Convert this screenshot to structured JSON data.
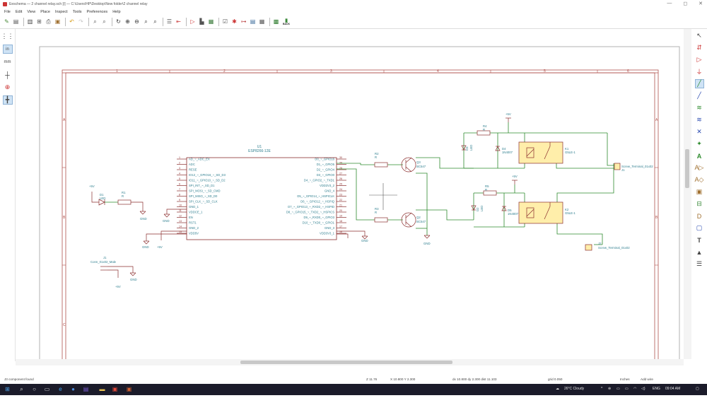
{
  "window": {
    "title": "Eeschema — 2 channel relay.sch [/] — C:\\Users\\HP\\Desktop\\New folder\\2 channel relay",
    "controls": [
      "—",
      "◻",
      "✕"
    ]
  },
  "menu": [
    "File",
    "Edit",
    "View",
    "Place",
    "Inspect",
    "Tools",
    "Preferences",
    "Help"
  ],
  "toolbar": {
    "back_label": "BACK",
    "icons": [
      "new-schematic-icon",
      "open-schematic-icon",
      "save-icon",
      "page-settings-icon",
      "print-icon",
      "plot-icon",
      "paste-icon",
      "undo-icon",
      "redo-icon",
      "find-icon",
      "find-replace-icon",
      "refresh-icon",
      "zoom-in-icon",
      "zoom-out-icon",
      "zoom-fit-icon",
      "zoom-selection-icon",
      "hierarchy-navigator-icon",
      "leave-sheet-icon",
      "symbol-editor-icon",
      "symbol-browser-icon",
      "annotate-icon",
      "erc-icon",
      "netlist-icon",
      "assign-footprints-icon",
      "bom-icon",
      "pcbnew-icon"
    ]
  },
  "left_toolbar": [
    "grid-toggle-icon",
    "units-inches-icon",
    "units-mm-icon",
    "cursor-shape-icon",
    "hidden-pins-icon",
    "wire-orientation-icon"
  ],
  "right_toolbar": [
    "select-icon",
    "highlight-net-icon",
    "add-symbol-icon",
    "add-power-icon",
    "add-wire-icon",
    "add-bus-icon",
    "wire-to-bus-entry-icon",
    "bus-to-bus-entry-icon",
    "no-connect-icon",
    "add-junction-icon",
    "add-label-icon",
    "add-global-label-icon",
    "add-hier-label-icon",
    "add-hier-sheet-icon",
    "import-sheet-pin-icon",
    "add-sheet-pin-icon",
    "add-graphic-line-icon",
    "add-text-icon",
    "add-image-icon",
    "delete-icon"
  ],
  "schematic": {
    "border_numbers": [
      "1",
      "2",
      "3",
      "4",
      "5",
      "6"
    ],
    "border_letters": [
      "A",
      "B",
      "C"
    ],
    "u1": {
      "ref": "U1",
      "value": "ESP8266-12E",
      "left_pins": [
        "AD_~_ADC_EX",
        "ADC",
        "RESE",
        "IO12_~_GPIO16_~_SD_D3",
        "IO11_~_GPIO10_~_SD_D2",
        "SPI_INT_~_SD_D1",
        "SPI_MOSI_~_SD_CMD",
        "SPI_MISO_~_SD_D0",
        "SPI_CLK_~_SD_CLK",
        "GND_1",
        "VDDCE_1",
        "EN",
        "RST1",
        "GND_2",
        "VDD5V"
      ],
      "right_pins": [
        "D0_~_GPIO16",
        "D1_~_GPIO5",
        "D2_~_GPIO4",
        "D3_~_GPIO0",
        "D4_~_GPIO2_~_TXD1",
        "VDD3V3_2",
        "GND_4",
        "D5_~_GPIO14_~_HSPICLK",
        "D6_~_GPIO12_~_HSPIQ",
        "D7_~_GPIO13_~_RXD2_~_HSPID",
        "D8_~_GPIO15_~_TXD2_~_HSPICS",
        "D9_~_RXD0_~_GPIO3",
        "D10_~_TXD0_~_GPIO1",
        "GND_3",
        "VDD3V3_1"
      ],
      "left_pin_numbers": [
        "1",
        "2",
        "3",
        "4",
        "5",
        "6",
        "7",
        "8",
        "9",
        "10",
        "11",
        "12",
        "13",
        "14",
        "15"
      ],
      "right_pin_numbers": [
        "30",
        "29",
        "28",
        "27",
        "26",
        "25",
        "24",
        "23",
        "22",
        "21",
        "20",
        "19",
        "18",
        "17",
        "16"
      ]
    },
    "d1": {
      "ref": "D1",
      "value": "LED"
    },
    "r1": {
      "ref": "R1",
      "value": "R"
    },
    "r2": {
      "ref": "R2",
      "value": "R"
    },
    "r3": {
      "ref": "R3",
      "value": "R"
    },
    "r4": {
      "ref": "R4",
      "value": "R"
    },
    "r5": {
      "ref": "R5",
      "value": "R"
    },
    "q3": {
      "ref": "Q3",
      "value": "BC547"
    },
    "q2": {
      "ref": "Q2",
      "value": "BC547"
    },
    "d3": {
      "ref": "D3",
      "value": "LED"
    },
    "d2": {
      "ref": "D2",
      "value": "LED"
    },
    "d4": {
      "ref": "D4",
      "value": "1N4007"
    },
    "d5": {
      "ref": "D5",
      "value": "1N4007"
    },
    "k1": {
      "ref": "K1",
      "value": "G5LE-1"
    },
    "k2": {
      "ref": "K2",
      "value": "G5LE-1"
    },
    "j1": {
      "ref": "J1",
      "value": "Screw_Terminal_01x02"
    },
    "j2": {
      "ref": "J2",
      "value": "Screw_Terminal_01x02"
    },
    "j3": {
      "ref": "J1",
      "value": "Conn_01x02_Male"
    },
    "power": {
      "vcc": "+5V",
      "gnd": "GND"
    }
  },
  "status": {
    "message": "J3 component found",
    "z": "Z 11.76",
    "xy": "X 10.800  Y 2.300",
    "dxy": "dx 10.800  dy 2.300  dist 11.103",
    "grid": "grid 0.050",
    "units": "Inches",
    "mode": "Add wire"
  },
  "taskbar": {
    "weather": "26°C  Cloudy",
    "lang": "ENG",
    "time": "09:04 AM"
  },
  "colors": {
    "border_red": "#b0524d",
    "wire_green": "#2e8b2e",
    "symbol_brown": "#8b2e2e",
    "text_teal": "#2f7f8f",
    "relay_fill": "#ffeeaa"
  }
}
